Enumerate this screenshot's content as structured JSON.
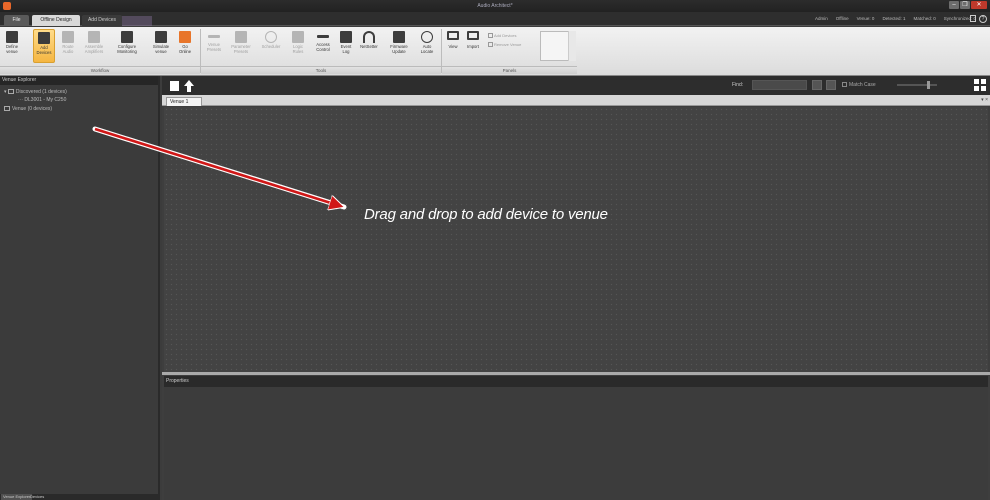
{
  "window": {
    "title": "Audio Architect*"
  },
  "tabs": {
    "file": "File",
    "offline_design": "Offline Design",
    "add_devices": "Add Devices"
  },
  "status": {
    "admin": "Admin",
    "offline": "Offline",
    "venue": "Venue: 0",
    "detected": "Detected: 1",
    "matched": "Matched: 0",
    "synchronized": "Synchronized: 0"
  },
  "help_glyph": "?",
  "ribbon": {
    "buttons": [
      {
        "label": "Define\nvenue",
        "icon": "define-venue-icon"
      },
      {
        "label": "Add\nDevices",
        "icon": "add-devices-icon"
      },
      {
        "label": "Route\nAudio",
        "icon": "route-audio-icon"
      },
      {
        "label": "Assemble\nAmplifiers",
        "icon": "assemble-amplifiers-icon"
      },
      {
        "label": "Configure\nMonitoring",
        "icon": "configure-monitoring-icon"
      },
      {
        "label": "Simulate\nvenue",
        "icon": "simulate-venue-icon"
      },
      {
        "label": "Go\nOnline",
        "icon": "go-online-icon"
      },
      {
        "label": "Venue\nPresets",
        "icon": "venue-presets-icon"
      },
      {
        "label": "Parameter\nPresets",
        "icon": "parameter-presets-icon"
      },
      {
        "label": "Scheduler",
        "icon": "scheduler-icon"
      },
      {
        "label": "Logic\nRules",
        "icon": "logic-rules-icon"
      },
      {
        "label": "Access\nControl",
        "icon": "access-control-icon"
      },
      {
        "label": "Event\nLog",
        "icon": "event-log-icon"
      },
      {
        "label": "NetSetter",
        "icon": "netsetter-icon"
      },
      {
        "label": "Firmware\nUpdate",
        "icon": "firmware-update-icon"
      },
      {
        "label": "Auto\nLocate",
        "icon": "auto-locate-icon"
      },
      {
        "label": "View",
        "icon": "view-icon"
      },
      {
        "label": "Import",
        "icon": "import-icon"
      }
    ],
    "groups": {
      "workflow": "Workflow",
      "tools": "Tools",
      "panels": "Panels"
    },
    "panel_options": [
      "Add Devices",
      "Remove Venue"
    ]
  },
  "explorer": {
    "title": "Venue Explorer",
    "tree": [
      "Discovered (1 devices)",
      "DL3001 - My C250",
      "Venue (0 devices)"
    ],
    "bottom_tabs": [
      "Venue Explorer",
      "Devices"
    ]
  },
  "main": {
    "find_label": "Find:",
    "match_case": "Match Case",
    "doc_tab": "Venue 1",
    "tab_scroll_glyph": "▾ ×",
    "hint": "Drag and drop to add device to venue",
    "properties_title": "Properties"
  }
}
